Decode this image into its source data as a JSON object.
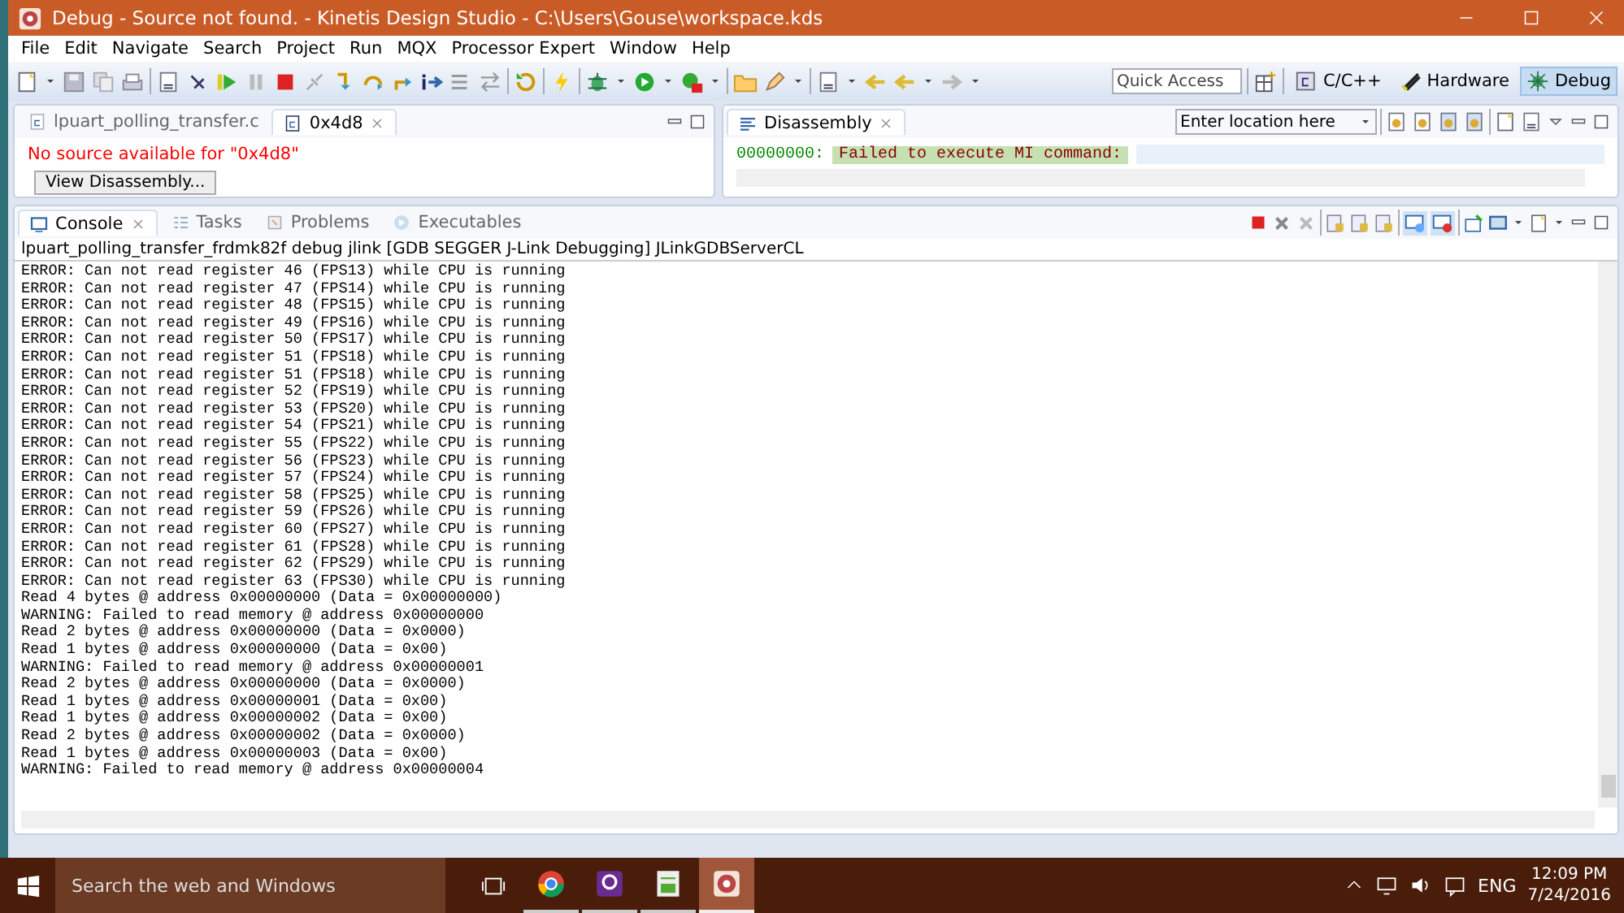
{
  "window": {
    "title": "Debug - Source not found. - Kinetis Design Studio - C:\\Users\\Gouse\\workspace.kds"
  },
  "menu": [
    "File",
    "Edit",
    "Navigate",
    "Search",
    "Project",
    "Run",
    "MQX",
    "Processor Expert",
    "Window",
    "Help"
  ],
  "quick_access": {
    "placeholder": "Quick Access"
  },
  "perspectives": [
    {
      "label": "C/C++",
      "selected": false
    },
    {
      "label": "Hardware",
      "selected": false
    },
    {
      "label": "Debug",
      "selected": true
    }
  ],
  "editor": {
    "tabs": [
      {
        "label": "lpuart_polling_transfer.c",
        "selected": false
      },
      {
        "label": "0x4d8",
        "selected": true
      }
    ],
    "message": "No source available for \"0x4d8\"",
    "button": "View Disassembly..."
  },
  "disassembly": {
    "tab": "Disassembly",
    "location": {
      "placeholder": "Enter location here"
    },
    "address": "00000000:",
    "text": "Failed to execute MI command:"
  },
  "console": {
    "tabs": [
      {
        "label": "Console",
        "selected": true
      },
      {
        "label": "Tasks",
        "selected": false
      },
      {
        "label": "Problems",
        "selected": false
      },
      {
        "label": "Executables",
        "selected": false
      }
    ],
    "process": "lpuart_polling_transfer_frdmk82f debug jlink [GDB SEGGER J-Link Debugging] JLinkGDBServerCL",
    "lines": [
      "ERROR: Can not read register 46 (FPS13) while CPU is running",
      "ERROR: Can not read register 47 (FPS14) while CPU is running",
      "ERROR: Can not read register 48 (FPS15) while CPU is running",
      "ERROR: Can not read register 49 (FPS16) while CPU is running",
      "ERROR: Can not read register 50 (FPS17) while CPU is running",
      "ERROR: Can not read register 51 (FPS18) while CPU is running",
      "ERROR: Can not read register 51 (FPS18) while CPU is running",
      "ERROR: Can not read register 52 (FPS19) while CPU is running",
      "ERROR: Can not read register 53 (FPS20) while CPU is running",
      "ERROR: Can not read register 54 (FPS21) while CPU is running",
      "ERROR: Can not read register 55 (FPS22) while CPU is running",
      "ERROR: Can not read register 56 (FPS23) while CPU is running",
      "ERROR: Can not read register 57 (FPS24) while CPU is running",
      "ERROR: Can not read register 58 (FPS25) while CPU is running",
      "ERROR: Can not read register 59 (FPS26) while CPU is running",
      "ERROR: Can not read register 60 (FPS27) while CPU is running",
      "ERROR: Can not read register 61 (FPS28) while CPU is running",
      "ERROR: Can not read register 62 (FPS29) while CPU is running",
      "ERROR: Can not read register 63 (FPS30) while CPU is running",
      "Read 4 bytes @ address 0x00000000 (Data = 0x00000000)",
      "WARNING: Failed to read memory @ address 0x00000000",
      "Read 2 bytes @ address 0x00000000 (Data = 0x0000)",
      "Read 1 bytes @ address 0x00000000 (Data = 0x00)",
      "WARNING: Failed to read memory @ address 0x00000001",
      "Read 2 bytes @ address 0x00000000 (Data = 0x0000)",
      "Read 1 bytes @ address 0x00000001 (Data = 0x00)",
      "Read 1 bytes @ address 0x00000002 (Data = 0x00)",
      "Read 2 bytes @ address 0x00000002 (Data = 0x0000)",
      "Read 1 bytes @ address 0x00000003 (Data = 0x00)",
      "WARNING: Failed to read memory @ address 0x00000004"
    ]
  },
  "taskbar": {
    "search": {
      "placeholder": "Search the web and Windows"
    },
    "apps": [
      {
        "selected": false
      },
      {
        "selected": false
      },
      {
        "selected": false
      },
      {
        "selected": true
      }
    ],
    "language": "ENG",
    "time": "12:09 PM",
    "date": "7/24/2016"
  }
}
